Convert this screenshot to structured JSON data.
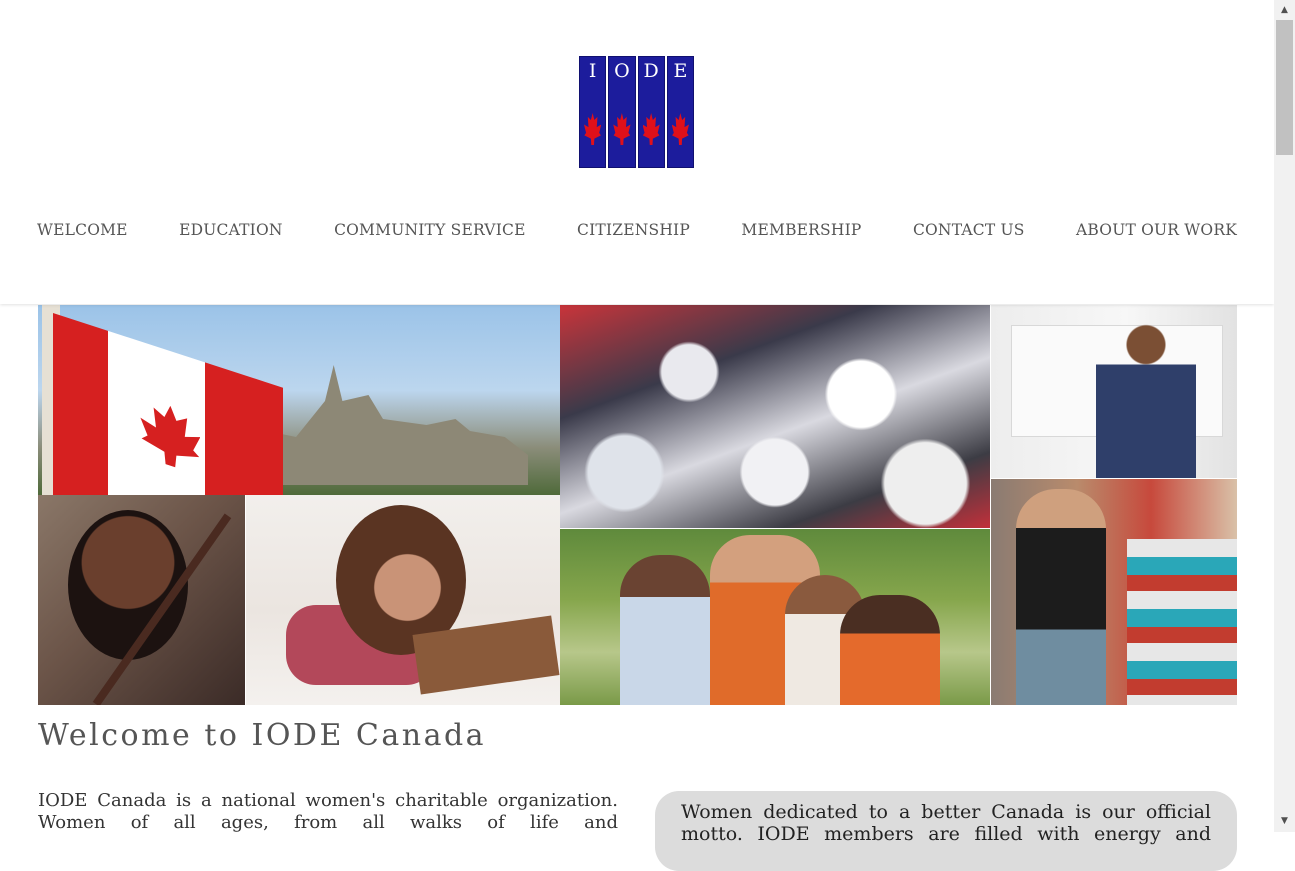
{
  "header": {
    "logo_letters": [
      "I",
      "O",
      "D",
      "E"
    ],
    "logo_colors": {
      "bar": "#1c1c9c",
      "leaf": "#e0101a"
    }
  },
  "nav": {
    "items": [
      {
        "label": "WELCOME"
      },
      {
        "label": "EDUCATION"
      },
      {
        "label": "COMMUNITY SERVICE"
      },
      {
        "label": "CITIZENSHIP"
      },
      {
        "label": "MEMBERSHIP"
      },
      {
        "label": "CONTACT US"
      },
      {
        "label": "ABOUT OUR WORK"
      }
    ]
  },
  "main": {
    "title": "Welcome to IODE Canada",
    "intro": "IODE Canada is a national women's charitable organization. Women of all ages, from all walks of life and",
    "quote": "Women dedicated to a better Canada is our official motto. IODE members are filled with energy and"
  },
  "scrollbar": {
    "up_icon": "▲",
    "down_icon": "▼"
  }
}
